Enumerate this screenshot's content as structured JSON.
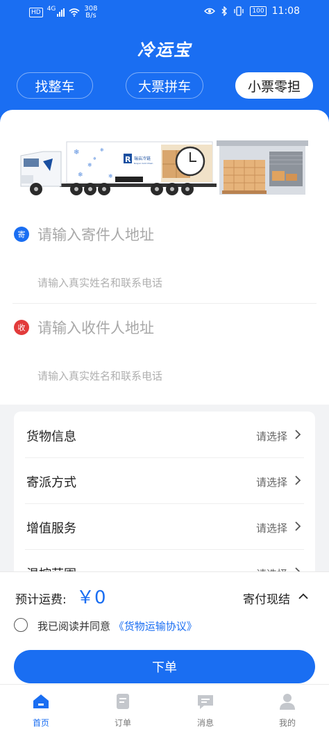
{
  "status_bar": {
    "network_badge": "HD",
    "network_gen": "4G",
    "speed_value": "308",
    "speed_unit": "B/s",
    "battery": "100",
    "time": "11:08"
  },
  "app_title": "冷运宝",
  "tabs": [
    {
      "label": "找整车",
      "selected": false
    },
    {
      "label": "大票拼车",
      "selected": false
    },
    {
      "label": "小票零担",
      "selected": true
    }
  ],
  "banner": {
    "truck_brand_text": "瑞云冷链",
    "truck_brand_sub": "Ruiyun Cold Chain"
  },
  "sender": {
    "badge": "寄",
    "address_placeholder": "请输入寄件人地址",
    "contact_placeholder": "请输入真实姓名和联系电话"
  },
  "receiver": {
    "badge": "收",
    "address_placeholder": "请输入收件人地址",
    "contact_placeholder": "请输入真实姓名和联系电话"
  },
  "options": [
    {
      "label": "货物信息",
      "value": "请选择"
    },
    {
      "label": "寄派方式",
      "value": "请选择"
    },
    {
      "label": "增值服务",
      "value": "请选择"
    },
    {
      "label": "温控范围",
      "value": "请选择"
    }
  ],
  "fee": {
    "label": "预计运费:",
    "value": "￥0",
    "payment_method": "寄付现结"
  },
  "agreement": {
    "checked": false,
    "text": "我已阅读并同意",
    "link": "《货物运输协议》"
  },
  "submit_label": "下单",
  "colors": {
    "primary": "#1a6ef2",
    "receiver_badge": "#e23b3b"
  },
  "nav": [
    {
      "label": "首页",
      "icon": "home-icon",
      "active": true
    },
    {
      "label": "订单",
      "icon": "order-icon",
      "active": false
    },
    {
      "label": "消息",
      "icon": "message-icon",
      "active": false
    },
    {
      "label": "我的",
      "icon": "profile-icon",
      "active": false
    }
  ]
}
